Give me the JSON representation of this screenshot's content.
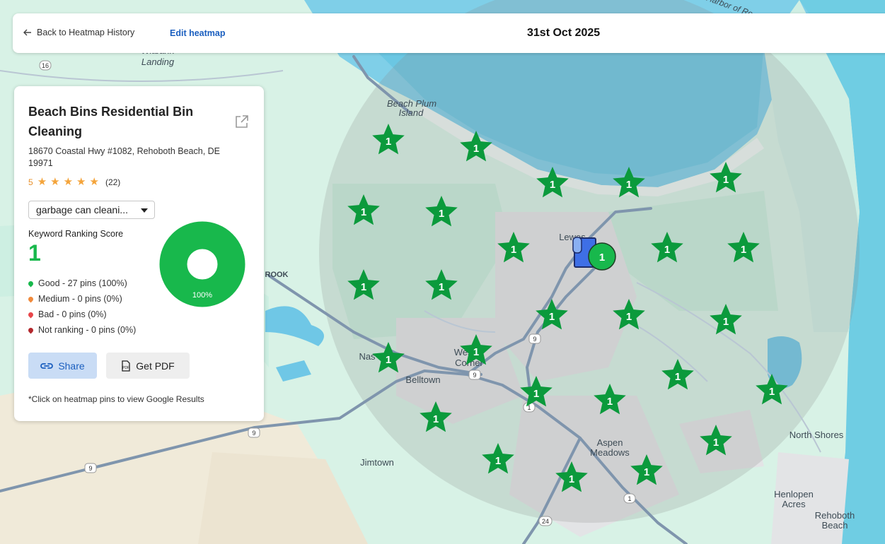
{
  "header": {
    "back_label": "Back to Heatmap History",
    "edit_label": "Edit heatmap",
    "date": "31st Oct 2025"
  },
  "business": {
    "name": "Beach Bins Residential Bin Cleaning",
    "address": "18670 Coastal Hwy #1082, Rehoboth Beach, DE 19971",
    "rating": "5",
    "review_count": "(22)",
    "stars": 5
  },
  "keyword": {
    "selected": "garbage can cleani..."
  },
  "score": {
    "label": "Keyword Ranking Score",
    "value": "1",
    "donut_percent_label": "100%",
    "good_fraction": 1.0
  },
  "legend": [
    {
      "text": "Good - 27 pins (100%)",
      "color": "#18b84c"
    },
    {
      "text": "Medium - 0 pins (0%)",
      "color": "#f08a3c"
    },
    {
      "text": "Bad - 0 pins (0%)",
      "color": "#e8464a"
    },
    {
      "text": "Not ranking - 0 pins (0%)",
      "color": "#b3282d"
    }
  ],
  "actions": {
    "share_label": "Share",
    "pdf_label": "Get PDF"
  },
  "note": "*Click on heatmap pins to view Google Results",
  "map": {
    "pin_rank": "1",
    "pin_color": "#0b9a3c",
    "center_pin_color": "#18b84c",
    "place_labels": [
      "Beach Plum",
      "Island",
      "Witbank",
      "Landing",
      "ROOK",
      "Lewes",
      "Nas",
      "Westo",
      "Corner",
      "Belltown",
      "Jimtown",
      "Aspen",
      "Meadows",
      "North Shores",
      "Henlopen",
      "Acres",
      "Rehoboth",
      "Beach",
      "Harbor of Re"
    ],
    "road_shields": [
      "16",
      "9",
      "9",
      "9",
      "9",
      "1",
      "1",
      "24"
    ]
  }
}
